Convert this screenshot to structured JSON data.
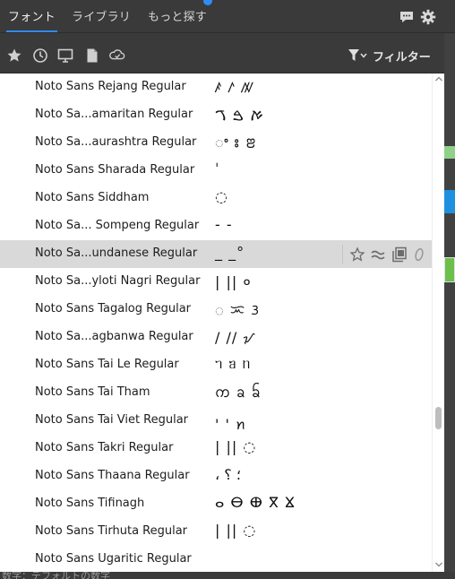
{
  "tabs": [
    {
      "label": "フォント",
      "active": true
    },
    {
      "label": "ライブラリ",
      "active": false
    },
    {
      "label": "もっと探す",
      "active": false
    }
  ],
  "top_icons": [
    "chat-icon",
    "gear-icon"
  ],
  "toolbar": {
    "icons": [
      "star-icon",
      "clock-icon",
      "monitor-icon",
      "document-icon",
      "cloud-check-icon"
    ],
    "filter_label": "フィルター"
  },
  "fonts": [
    {
      "name": "Noto Sans Rejang Regular",
      "sample": "ꤰ ꤱ ꤲ"
    },
    {
      "name": "Noto Sa...amaritan Regular",
      "sample": "ࠀ ࠁ ࠂ"
    },
    {
      "name": "Noto Sa...aurashtra Regular",
      "sample": "ꢀ ꢁ ꢂ"
    },
    {
      "name": "Noto Sans Sharada Regular",
      "sample": "ˈ"
    },
    {
      "name": "Noto Sans Siddham",
      "sample": "◌"
    },
    {
      "name": "Noto Sa... Sompeng Regular",
      "sample": "- -"
    },
    {
      "name": "Noto Sa...undanese Regular",
      "sample": "_ _°",
      "selected": true
    },
    {
      "name": "Noto Sa...yloti Nagri Regular",
      "sample": "| || ०"
    },
    {
      "name": "Noto Sans Tagalog Regular",
      "sample": "ᜀ ᜁ ᜂ"
    },
    {
      "name": "Noto Sa...agbanwa Regular",
      "sample": "/ // ᝠ"
    },
    {
      "name": "Noto Sans Tai Le Regular",
      "sample": "ᥐ ᥑ ᥒ"
    },
    {
      "name": "Noto Sans Tai Tham",
      "sample": "ᨠ ᨡ ᨢ"
    },
    {
      "name": "Noto Sans Tai Viet Regular",
      "sample": "' ' ꪀ"
    },
    {
      "name": "Noto Sans Takri Regular",
      "sample": "| || ◌"
    },
    {
      "name": "Noto Sans Thaana Regular",
      "sample": "، ؛ ؟"
    },
    {
      "name": "Noto Sans Tifinagh",
      "sample": "ⴰ ⴱ ⴲ ⴳ ⴴ"
    },
    {
      "name": "Noto Sans Tirhuta Regular",
      "sample": "| || ◌"
    },
    {
      "name": "Noto Sans Ugaritic Regular",
      "sample": ""
    }
  ],
  "row_actions": [
    "star-outline-icon",
    "approx-icon",
    "duplicate-icon",
    "italic-o-icon"
  ],
  "bottom_text": "数字：デフォルトの数字",
  "colors": {
    "accent": "#2f8cf6",
    "selected_row": "#d9d9d9",
    "chrome": "#3a3a3a",
    "green_strip": "#8fd18a",
    "blue_strip": "#1e90e0"
  }
}
